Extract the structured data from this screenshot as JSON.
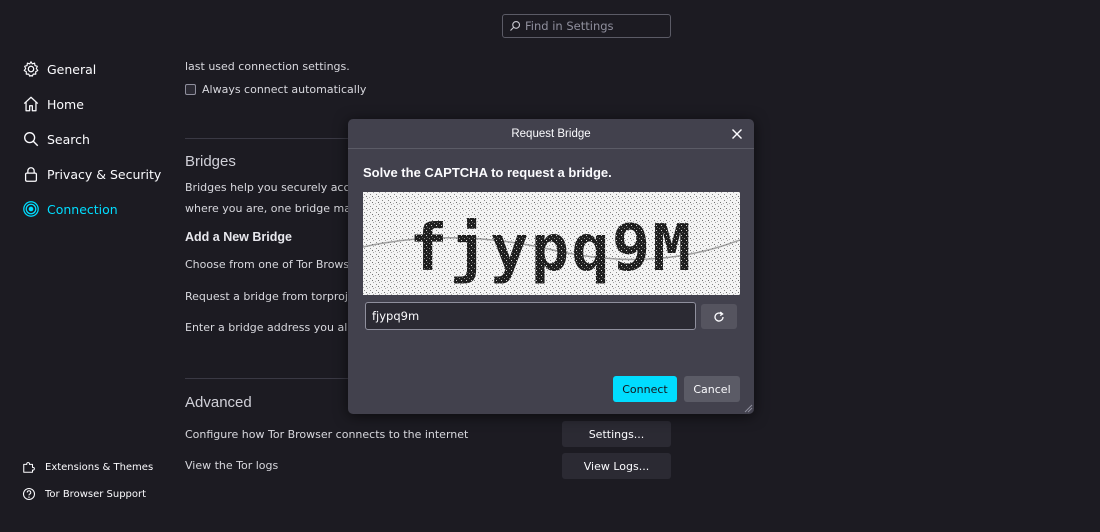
{
  "search": {
    "placeholder": "Find in Settings"
  },
  "sidebar": {
    "items": [
      {
        "label": "General",
        "icon": "gear-icon"
      },
      {
        "label": "Home",
        "icon": "home-icon"
      },
      {
        "label": "Search",
        "icon": "search-icon"
      },
      {
        "label": "Privacy & Security",
        "icon": "lock-icon"
      },
      {
        "label": "Connection",
        "icon": "connection-icon",
        "active": true
      }
    ],
    "footer": [
      {
        "label": "Extensions & Themes",
        "icon": "puzzle-icon"
      },
      {
        "label": "Tor Browser Support",
        "icon": "help-icon"
      }
    ]
  },
  "main": {
    "intro_tail": "last used connection settings.",
    "always_connect_label": "Always connect automatically",
    "bridges": {
      "title": "Bridges",
      "desc_line1": "Bridges help you securely access t",
      "desc_line2": "where you are, one bridge may wo",
      "add_title": "Add a New Bridge",
      "choose_text": "Choose from one of Tor Browser's",
      "request_text": "Request a bridge from torproject.c",
      "enter_text": "Enter a bridge address you already"
    },
    "advanced": {
      "title": "Advanced",
      "configure_text": "Configure how Tor Browser connects to the internet",
      "settings_button": "Settings...",
      "logs_text": "View the Tor logs",
      "logs_button": "View Logs..."
    }
  },
  "dialog": {
    "title": "Request Bridge",
    "heading": "Solve the CAPTCHA to request a bridge.",
    "captcha_text": "fjypq9M",
    "input_value": "fjypq9m",
    "connect_label": "Connect",
    "cancel_label": "Cancel"
  },
  "colors": {
    "background": "#1c1b22",
    "dialog": "#42414d",
    "accent": "#00ddff"
  }
}
